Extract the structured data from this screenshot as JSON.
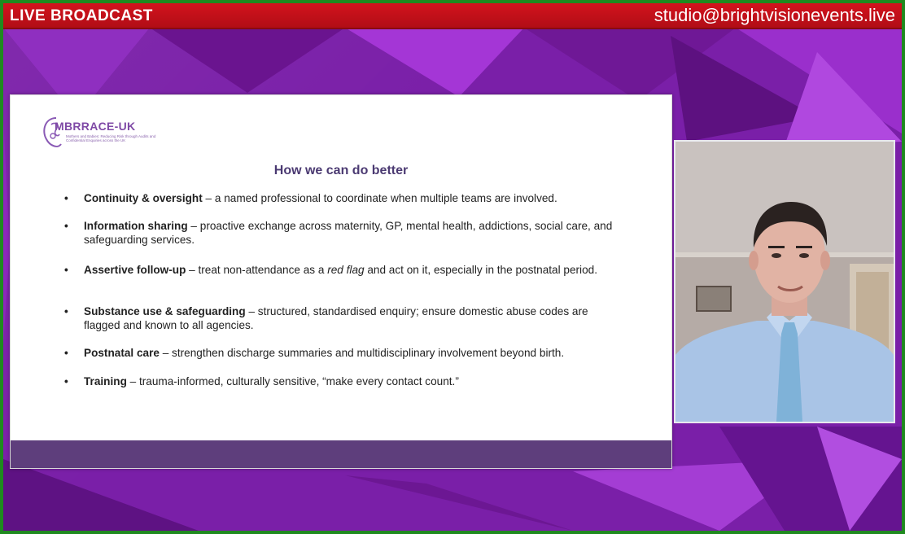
{
  "header": {
    "live_label": "LIVE BROADCAST",
    "contact_email": "studio@brightvisionevents.live"
  },
  "slide": {
    "logo": {
      "name": "MBRRACE-UK",
      "tagline": "Mothers and Babies: Reducing Risk through Audits and Confidential Enquiries across the UK"
    },
    "title": "How we can do better",
    "bullets": [
      {
        "head": "Continuity & oversight",
        "text": " – a named professional to coordinate when multiple teams are involved."
      },
      {
        "head": "Information sharing",
        "text": " – proactive exchange across maternity, GP, mental health, addictions, social care, and safeguarding services."
      },
      {
        "head": "Assertive follow-up",
        "text": " – treat non-attendance as a ",
        "em": "red flag",
        "tail": " and act on it, especially in the postnatal period."
      },
      {
        "head": "Substance use & safeguarding",
        "text": " – structured, standardised enquiry; ensure domestic abuse codes are flagged and known to all agencies."
      },
      {
        "head": "Postnatal care",
        "text": " – strengthen discharge summaries and multidisciplinary involvement beyond birth."
      },
      {
        "head": "Training",
        "text": " – trauma-informed, culturally sensitive, “make every contact count.”"
      }
    ]
  },
  "colors": {
    "background_purple": "#7a1fa8",
    "live_bar_red": "#c8101a",
    "slide_footer": "#5e3e7c",
    "title_purple": "#4b3a72",
    "border_green": "#1f8a1f"
  }
}
